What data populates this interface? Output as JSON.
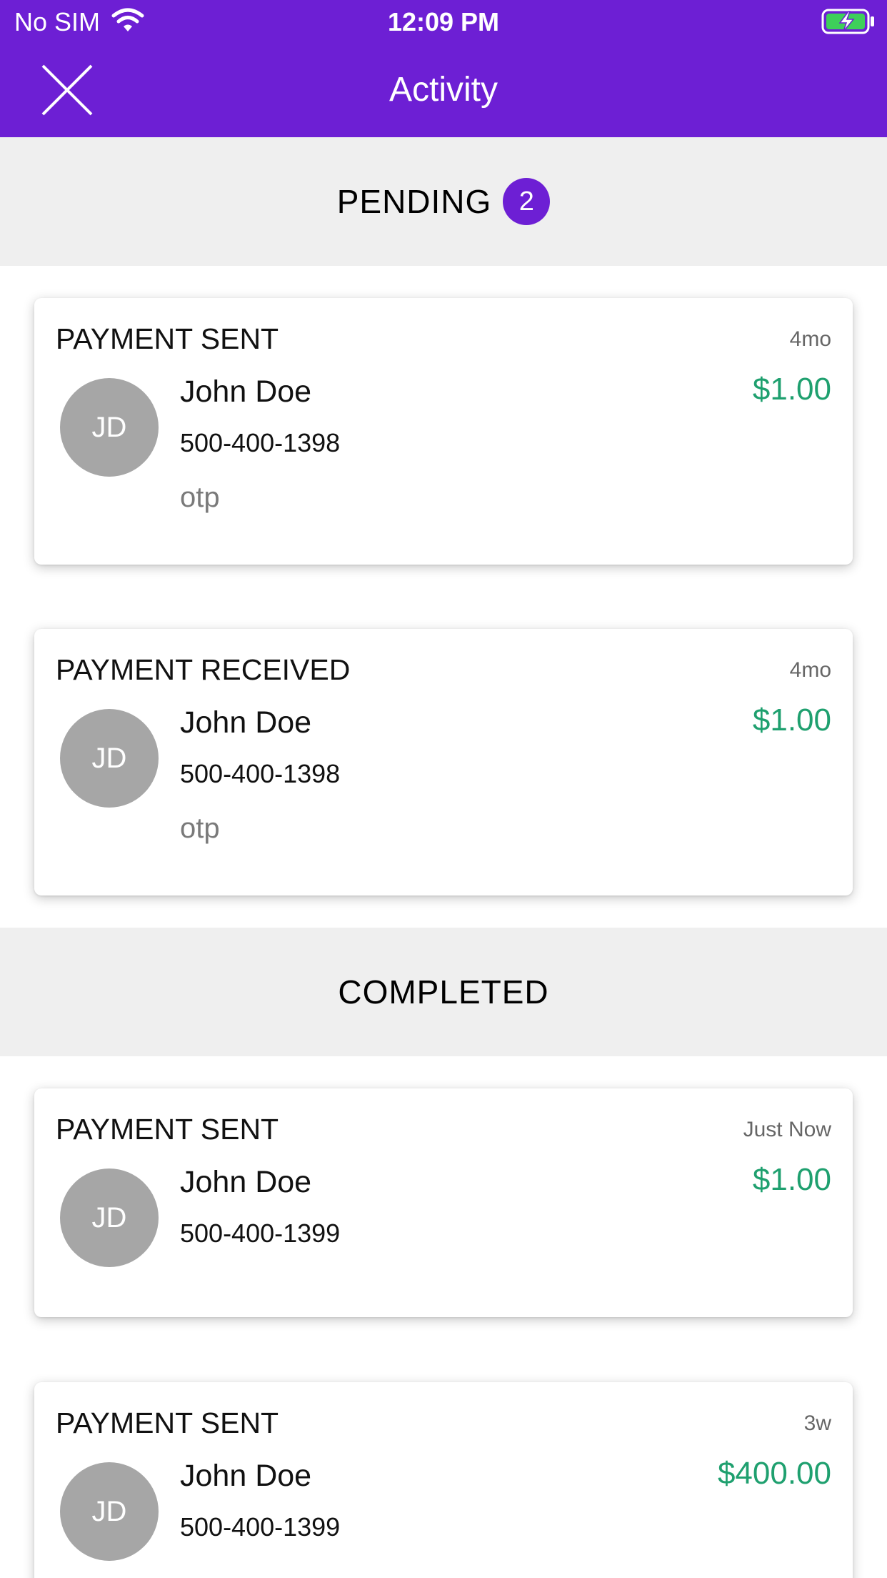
{
  "status_bar": {
    "carrier": "No SIM",
    "time": "12:09 PM",
    "wifi_icon": "wifi-icon",
    "battery_icon": "battery-charging-icon"
  },
  "nav": {
    "title": "Activity",
    "close_icon": "close-icon"
  },
  "colors": {
    "header_purple": "#6d1fd4",
    "section_bg": "#efefef",
    "amount_green": "#1fa06f",
    "avatar_gray": "#a6a6a6"
  },
  "pending": {
    "title": "PENDING",
    "count": "2",
    "items": [
      {
        "type": "PAYMENT SENT",
        "time": "4mo",
        "initials": "JD",
        "name": "John Doe",
        "phone": "500-400-1398",
        "note": "otp",
        "amount": "$1.00"
      },
      {
        "type": "PAYMENT RECEIVED",
        "time": "4mo",
        "initials": "JD",
        "name": "John Doe",
        "phone": "500-400-1398",
        "note": "otp",
        "amount": "$1.00"
      }
    ]
  },
  "completed": {
    "title": "COMPLETED",
    "items": [
      {
        "type": "PAYMENT SENT",
        "time": "Just Now",
        "initials": "JD",
        "name": "John Doe",
        "phone": "500-400-1399",
        "amount": "$1.00"
      },
      {
        "type": "PAYMENT SENT",
        "time": "3w",
        "initials": "JD",
        "name": "John Doe",
        "phone": "500-400-1399",
        "amount": "$400.00"
      }
    ]
  }
}
